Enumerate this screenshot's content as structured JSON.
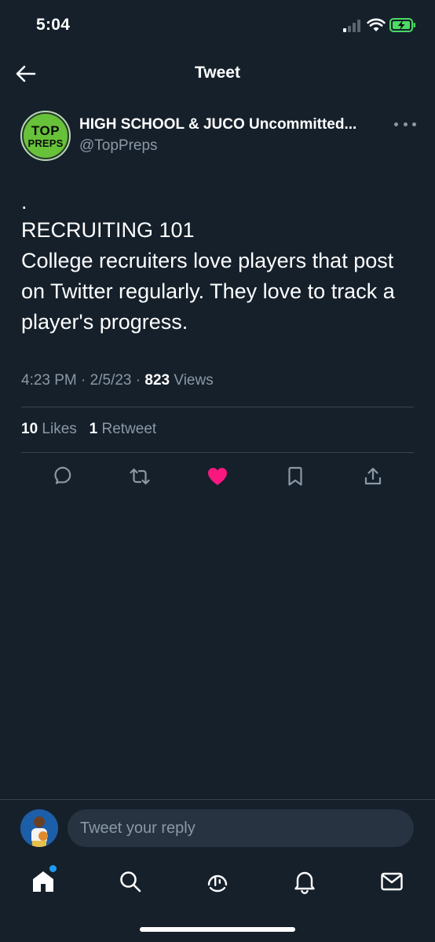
{
  "status_bar": {
    "time": "5:04"
  },
  "header": {
    "title": "Tweet"
  },
  "tweet": {
    "author": {
      "avatar_text_top": "TOP",
      "avatar_text_bottom": "PREPS",
      "name": "HIGH SCHOOL & JUCO Uncommitted...",
      "handle": "@TopPreps"
    },
    "body": {
      "line_dot": ".",
      "heading": "RECRUITING 101",
      "text": "College recruiters love players that post on Twitter regularly. They love to track a player's progress."
    },
    "meta": {
      "time": "4:23 PM",
      "separator": "·",
      "date": "2/5/23",
      "views_count": "823",
      "views_label": "Views"
    },
    "stats": {
      "likes_count": "10",
      "likes_label": "Likes",
      "retweets_count": "1",
      "retweets_label": "Retweet"
    },
    "actions": {
      "icons": [
        "comment-icon",
        "retweet-icon",
        "heart-icon",
        "bookmark-icon",
        "share-icon"
      ],
      "liked": true
    }
  },
  "reply": {
    "placeholder": "Tweet your reply"
  },
  "bottom_nav": {
    "items": [
      "home-icon",
      "search-icon",
      "spaces-icon",
      "notifications-icon",
      "messages-icon"
    ],
    "active": "home-icon"
  },
  "colors": {
    "background": "#15202b",
    "secondary_text": "#8b98a5",
    "divider": "#38444d",
    "like_pink": "#f91880",
    "accent_blue": "#1d9bf0",
    "avatar_green": "#67c23a"
  }
}
